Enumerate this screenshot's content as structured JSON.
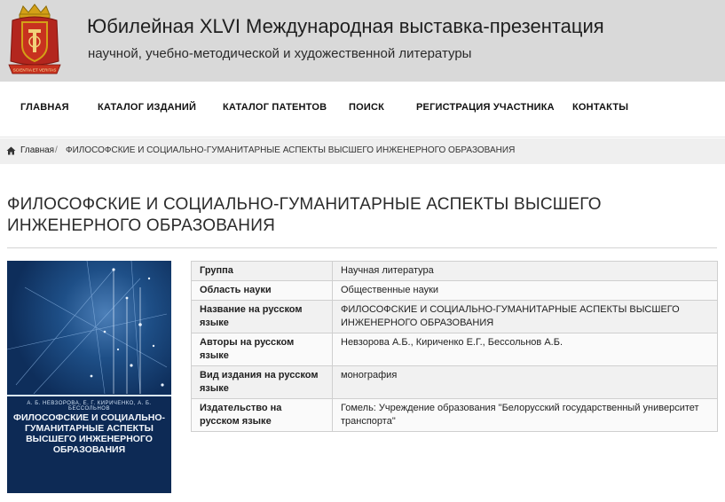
{
  "header": {
    "title": "Юбилейная XLVI Международная выставка-презентация",
    "subtitle": "научной, учебно-методической и художественной литературы",
    "logo_icon": "coat-of-arms-emblem",
    "logo_motto": "SCIENTIA ET VERITAS"
  },
  "nav": {
    "items": [
      {
        "label": "ГЛАВНАЯ"
      },
      {
        "label": "КАТАЛОГ ИЗДАНИЙ"
      },
      {
        "label": "КАТАЛОГ ПАТЕНТОВ"
      },
      {
        "label": "ПОИСК"
      },
      {
        "label": "РЕГИСТРАЦИЯ УЧАСТНИКА"
      },
      {
        "label": "КОНТАКТЫ"
      }
    ]
  },
  "breadcrumb": {
    "home_icon": "home-icon",
    "home": "Главная",
    "separator": "/",
    "current": "ФИЛОСОФСКИЕ И СОЦИАЛЬНО-ГУМАНИТАРНЫЕ АСПЕКТЫ ВЫСШЕГО ИНЖЕНЕРНОГО ОБРАЗОВАНИЯ"
  },
  "page": {
    "title": "ФИЛОСОФСКИЕ И СОЦИАЛЬНО-ГУМАНИТАРНЫЕ АСПЕКТЫ ВЫСШЕГО ИНЖЕНЕРНОГО ОБРАЗОВАНИЯ"
  },
  "cover": {
    "authors": "А. Б. НЕВЗОРОВА, Е. Г. КИРИЧЕНКО, А. Б. БЕССОЛЬНОВ",
    "title": "ФИЛОСОФСКИЕ И СОЦИАЛЬНО-ГУМАНИТАРНЫЕ АСПЕКТЫ ВЫСШЕГО ИНЖЕНЕРНОГО ОБРАЗОВАНИЯ"
  },
  "details": {
    "rows": [
      {
        "label": "Группа",
        "value": "Научная литература"
      },
      {
        "label": "Область науки",
        "value": "Общественные науки"
      },
      {
        "label": "Название на русском языке",
        "value": "ФИЛОСОФСКИЕ И СОЦИАЛЬНО-ГУМАНИТАРНЫЕ АСПЕКТЫ ВЫСШЕГО ИНЖЕНЕРНОГО ОБРАЗОВАНИЯ"
      },
      {
        "label": "Авторы на русском языке",
        "value": "Невзорова А.Б., Кириченко Е.Г., Бессольнов А.Б."
      },
      {
        "label": "Вид издания на русском языке",
        "value": "монография"
      },
      {
        "label": "Издательство на русском языке",
        "value": "Гомель: Учреждение образования \"Белорусский государственный университет транспорта\""
      }
    ]
  },
  "colors": {
    "header_bg": "#d9d9d9",
    "breadcrumb_bg": "#efefef",
    "cover_bg": "#0d2f5c",
    "emblem_red": "#b3261e",
    "emblem_gold": "#d4a017"
  }
}
